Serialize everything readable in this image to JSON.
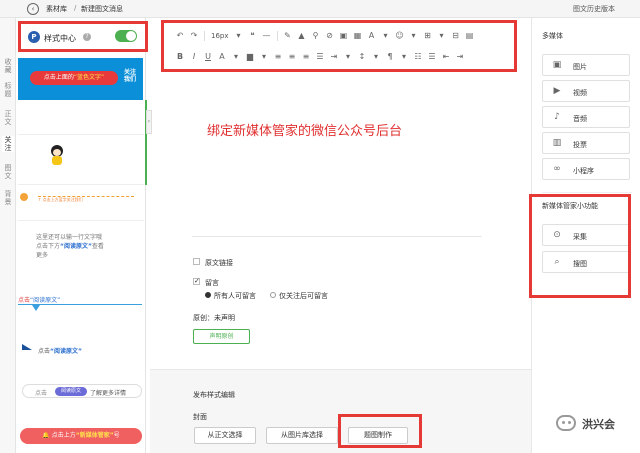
{
  "topbar": {
    "breadcrumb_1": "素材库",
    "breadcrumb_sep": "/",
    "breadcrumb_2": "新建图文消息",
    "history_link": "图文历史版本"
  },
  "left_tabs": [
    "收藏",
    "标题",
    "正文",
    "关注",
    "图文",
    "背景"
  ],
  "style_center": {
    "icon_letter": "P",
    "label": "样式中心",
    "help": "?",
    "enabled": true
  },
  "templates": {
    "banner_pre": "点击上面的",
    "banner_hl": "“蓝色文字”",
    "banner_follow_1": "关注",
    "banner_follow_2": "我们",
    "mini_row_text": "↑ 点击上方蓝字关注我们",
    "para_1": "这里还可以输一行文字哦",
    "para_2_pre": "点击下方",
    "para_2_hl": "“阅读原文”",
    "para_2_post": "查看",
    "para_3": "更多",
    "read_pre": "点击",
    "read_hl": "“阅读原文”",
    "read2_pre": "点击",
    "read2_hl": "“阅读原文”",
    "pill_pre": "点击",
    "pill_btn": "阅读原文",
    "pill_post": "了解更多详情",
    "red_pre": "点击上方",
    "red_hl": "“新媒体管家”",
    "red_post": "号"
  },
  "toolbar": {
    "font_size": "16px"
  },
  "editor": {
    "title": "绑定新媒体管家的微信公众号后台",
    "source_link_label": "原文链接",
    "comment_label": "留言",
    "comment_all": "所有人可留言",
    "comment_followers": "仅关注后可留言",
    "original_label": "原创：未声明",
    "original_button": "声明原创"
  },
  "publish": {
    "title": "发布样式编辑",
    "cover_label": "封面",
    "from_body": "从正文选择",
    "from_library": "从图片库选择",
    "make_image": "题图制作"
  },
  "right_panel": {
    "multimedia_heading": "多媒体",
    "items": [
      {
        "icon": "image-icon",
        "glyph": "▣",
        "label": "图片"
      },
      {
        "icon": "video-icon",
        "glyph": "▶",
        "label": "视频"
      },
      {
        "icon": "audio-icon",
        "glyph": "♪",
        "label": "音频"
      },
      {
        "icon": "poll-icon",
        "glyph": "▥",
        "label": "投票"
      },
      {
        "icon": "mini-program-icon",
        "glyph": "∞",
        "label": "小程序"
      }
    ],
    "tools_heading": "新媒体管家小功能",
    "tools": [
      {
        "icon": "collect-icon",
        "glyph": "⊙",
        "label": "采集"
      },
      {
        "icon": "search-image-icon",
        "glyph": "⌕",
        "label": "搜图"
      }
    ]
  },
  "watermark": {
    "text": "洪兴会"
  },
  "colors": {
    "annotation_red": "#e53935",
    "title_red": "#e03030",
    "toggle_green": "#4caf50"
  }
}
